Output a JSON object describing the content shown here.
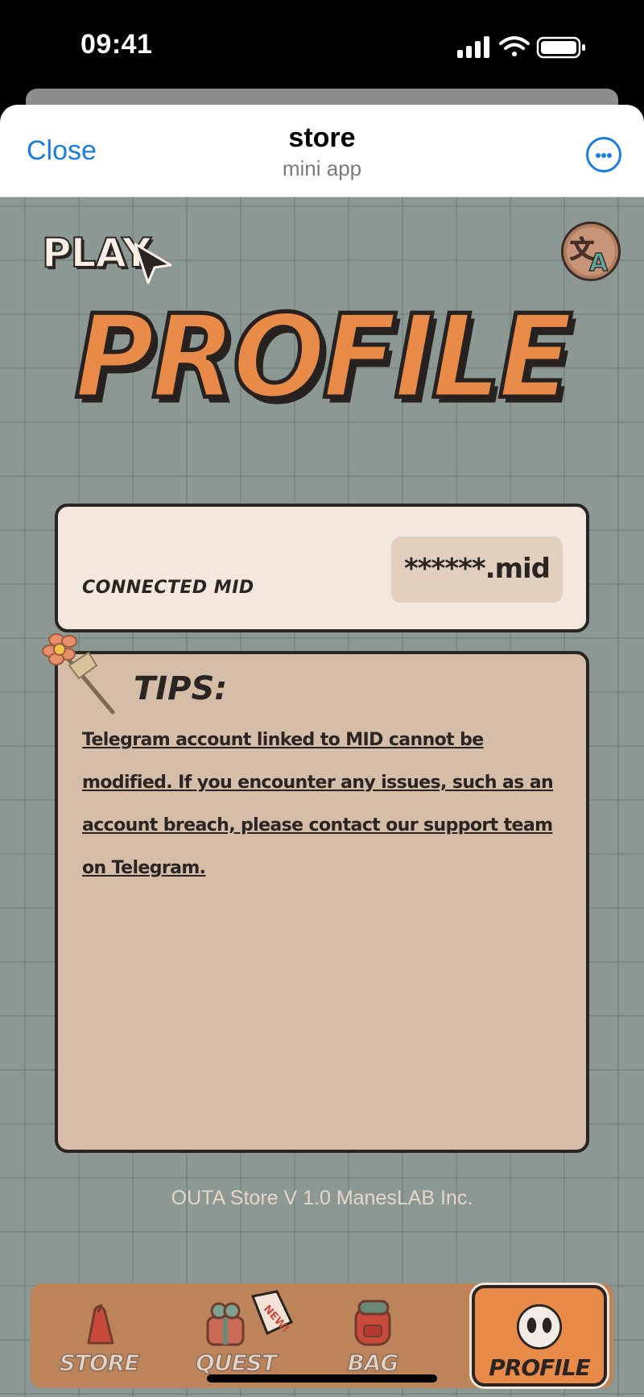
{
  "status_bar": {
    "time": "09:41"
  },
  "header": {
    "close_label": "Close",
    "title": "store",
    "subtitle": "mini app"
  },
  "top": {
    "play_logo_text": "PLAY"
  },
  "page_title": "PROFILE",
  "mid_card": {
    "label": "CONNECTED MID",
    "value": "******.mid"
  },
  "tips": {
    "title": "TIPS:",
    "body": "Telegram account linked to MID cannot be modified. If you encounter any issues, such as an account breach, please contact our support team on Telegram."
  },
  "footer": {
    "version_text": "OUTA Store V 1.0 ManesLAB Inc."
  },
  "nav": {
    "items": [
      {
        "label": "STORE",
        "icon": "store-icon"
      },
      {
        "label": "QUEST",
        "icon": "quest-icon",
        "badge": "NEW!"
      },
      {
        "label": "BAG",
        "icon": "bag-icon"
      },
      {
        "label": "PROFILE",
        "icon": "profile-icon",
        "active": true
      }
    ]
  },
  "colors": {
    "accent_orange": "#e88a48",
    "link_blue": "#1a7de0",
    "background_grid": "#8b9893",
    "card_light": "#f4e8de",
    "card_tan": "#d5bda7",
    "nav_bg": "#bd845a",
    "outline_dark": "#2a2523"
  }
}
